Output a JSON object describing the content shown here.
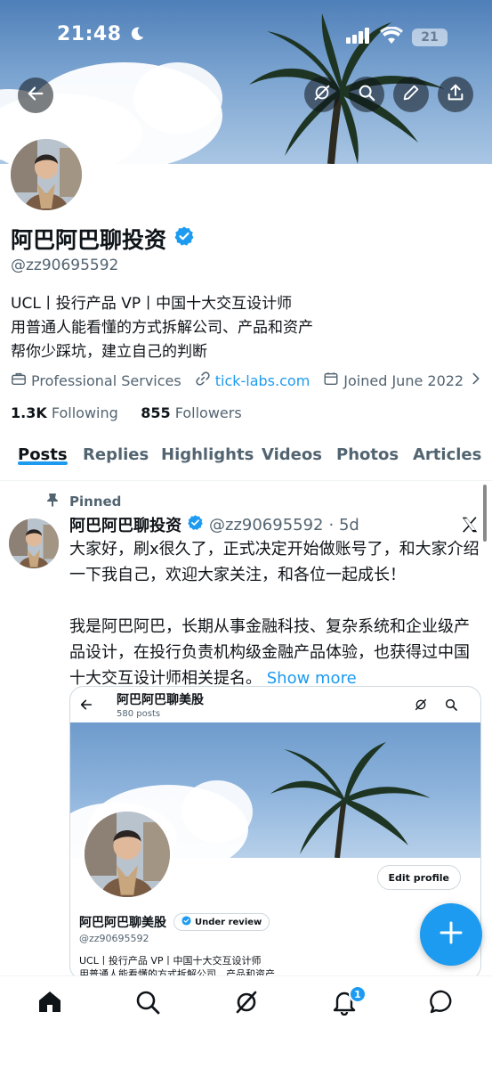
{
  "status_bar": {
    "time": "21:48",
    "battery": "21"
  },
  "profile": {
    "name": "阿巴阿巴聊投资",
    "handle": "@zz90695592",
    "bio": [
      "UCL丨投行产品 VP丨中国十大交互设计师",
      "用普通人能看懂的方式拆解公司、产品和资产",
      "帮你少踩坑，建立自己的判断"
    ],
    "category": "Professional Services",
    "website": "tick-labs.com",
    "joined": "Joined June 2022",
    "following_count": "1.3K",
    "following_label": "Following",
    "followers_count": "855",
    "followers_label": "Followers"
  },
  "tabs": [
    "Posts",
    "Replies",
    "Highlights",
    "Videos",
    "Photos",
    "Articles"
  ],
  "active_tab": "Posts",
  "post": {
    "pinned_label": "Pinned",
    "author_name": "阿巴阿巴聊投资",
    "author_handle": "@zz90695592",
    "time": "· 5d",
    "paragraph1": "大家好，刷x很久了，正式决定开始做账号了，和大家介绍一下我自己，欢迎大家关注，和各位一起成长！",
    "paragraph2": "我是阿巴阿巴，长期从事金融科技、复杂系统和企业级产品设计，在投行负责机构级金融产品体验，也获得过中国十大交互设计师相关提名。",
    "show_more": "Show more"
  },
  "embedded_card": {
    "title": "阿巴阿巴聊美股",
    "post_count": "580 posts",
    "edit_profile": "Edit profile",
    "name": "阿巴阿巴聊美股",
    "review_badge": "Under review",
    "handle": "@zz90695592",
    "bio_line1": "UCL丨投行产品 VP丨中国十大交互设计师",
    "bio_line2": "用普通人能看懂的方式拆解公司、产品和资产"
  },
  "notifications_badge": "1",
  "colors": {
    "accent": "#1d9bf0",
    "text": "#0f1419",
    "muted": "#536471"
  }
}
